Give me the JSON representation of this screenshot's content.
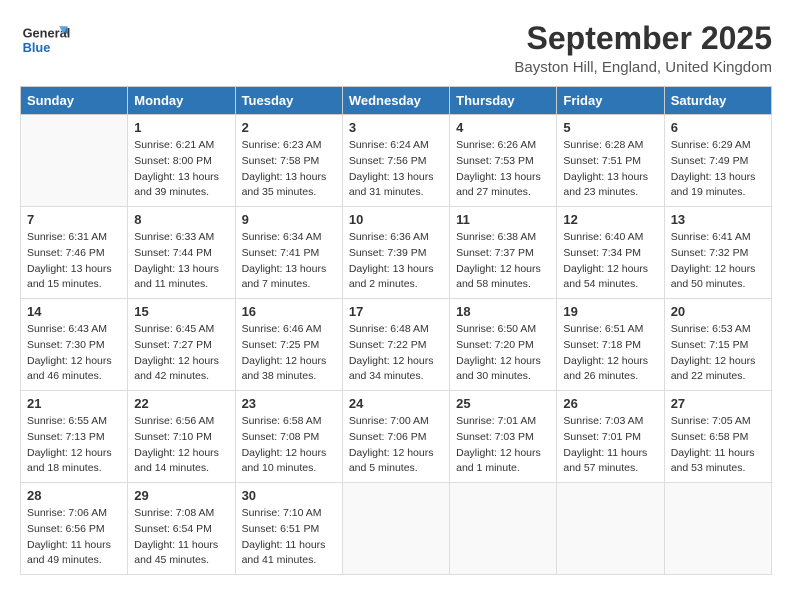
{
  "header": {
    "logo_line1": "General",
    "logo_line2": "Blue",
    "month": "September 2025",
    "location": "Bayston Hill, England, United Kingdom"
  },
  "days_of_week": [
    "Sunday",
    "Monday",
    "Tuesday",
    "Wednesday",
    "Thursday",
    "Friday",
    "Saturday"
  ],
  "weeks": [
    [
      {
        "day": "",
        "details": []
      },
      {
        "day": "1",
        "details": [
          "Sunrise: 6:21 AM",
          "Sunset: 8:00 PM",
          "Daylight: 13 hours",
          "and 39 minutes."
        ]
      },
      {
        "day": "2",
        "details": [
          "Sunrise: 6:23 AM",
          "Sunset: 7:58 PM",
          "Daylight: 13 hours",
          "and 35 minutes."
        ]
      },
      {
        "day": "3",
        "details": [
          "Sunrise: 6:24 AM",
          "Sunset: 7:56 PM",
          "Daylight: 13 hours",
          "and 31 minutes."
        ]
      },
      {
        "day": "4",
        "details": [
          "Sunrise: 6:26 AM",
          "Sunset: 7:53 PM",
          "Daylight: 13 hours",
          "and 27 minutes."
        ]
      },
      {
        "day": "5",
        "details": [
          "Sunrise: 6:28 AM",
          "Sunset: 7:51 PM",
          "Daylight: 13 hours",
          "and 23 minutes."
        ]
      },
      {
        "day": "6",
        "details": [
          "Sunrise: 6:29 AM",
          "Sunset: 7:49 PM",
          "Daylight: 13 hours",
          "and 19 minutes."
        ]
      }
    ],
    [
      {
        "day": "7",
        "details": [
          "Sunrise: 6:31 AM",
          "Sunset: 7:46 PM",
          "Daylight: 13 hours",
          "and 15 minutes."
        ]
      },
      {
        "day": "8",
        "details": [
          "Sunrise: 6:33 AM",
          "Sunset: 7:44 PM",
          "Daylight: 13 hours",
          "and 11 minutes."
        ]
      },
      {
        "day": "9",
        "details": [
          "Sunrise: 6:34 AM",
          "Sunset: 7:41 PM",
          "Daylight: 13 hours",
          "and 7 minutes."
        ]
      },
      {
        "day": "10",
        "details": [
          "Sunrise: 6:36 AM",
          "Sunset: 7:39 PM",
          "Daylight: 13 hours",
          "and 2 minutes."
        ]
      },
      {
        "day": "11",
        "details": [
          "Sunrise: 6:38 AM",
          "Sunset: 7:37 PM",
          "Daylight: 12 hours",
          "and 58 minutes."
        ]
      },
      {
        "day": "12",
        "details": [
          "Sunrise: 6:40 AM",
          "Sunset: 7:34 PM",
          "Daylight: 12 hours",
          "and 54 minutes."
        ]
      },
      {
        "day": "13",
        "details": [
          "Sunrise: 6:41 AM",
          "Sunset: 7:32 PM",
          "Daylight: 12 hours",
          "and 50 minutes."
        ]
      }
    ],
    [
      {
        "day": "14",
        "details": [
          "Sunrise: 6:43 AM",
          "Sunset: 7:30 PM",
          "Daylight: 12 hours",
          "and 46 minutes."
        ]
      },
      {
        "day": "15",
        "details": [
          "Sunrise: 6:45 AM",
          "Sunset: 7:27 PM",
          "Daylight: 12 hours",
          "and 42 minutes."
        ]
      },
      {
        "day": "16",
        "details": [
          "Sunrise: 6:46 AM",
          "Sunset: 7:25 PM",
          "Daylight: 12 hours",
          "and 38 minutes."
        ]
      },
      {
        "day": "17",
        "details": [
          "Sunrise: 6:48 AM",
          "Sunset: 7:22 PM",
          "Daylight: 12 hours",
          "and 34 minutes."
        ]
      },
      {
        "day": "18",
        "details": [
          "Sunrise: 6:50 AM",
          "Sunset: 7:20 PM",
          "Daylight: 12 hours",
          "and 30 minutes."
        ]
      },
      {
        "day": "19",
        "details": [
          "Sunrise: 6:51 AM",
          "Sunset: 7:18 PM",
          "Daylight: 12 hours",
          "and 26 minutes."
        ]
      },
      {
        "day": "20",
        "details": [
          "Sunrise: 6:53 AM",
          "Sunset: 7:15 PM",
          "Daylight: 12 hours",
          "and 22 minutes."
        ]
      }
    ],
    [
      {
        "day": "21",
        "details": [
          "Sunrise: 6:55 AM",
          "Sunset: 7:13 PM",
          "Daylight: 12 hours",
          "and 18 minutes."
        ]
      },
      {
        "day": "22",
        "details": [
          "Sunrise: 6:56 AM",
          "Sunset: 7:10 PM",
          "Daylight: 12 hours",
          "and 14 minutes."
        ]
      },
      {
        "day": "23",
        "details": [
          "Sunrise: 6:58 AM",
          "Sunset: 7:08 PM",
          "Daylight: 12 hours",
          "and 10 minutes."
        ]
      },
      {
        "day": "24",
        "details": [
          "Sunrise: 7:00 AM",
          "Sunset: 7:06 PM",
          "Daylight: 12 hours",
          "and 5 minutes."
        ]
      },
      {
        "day": "25",
        "details": [
          "Sunrise: 7:01 AM",
          "Sunset: 7:03 PM",
          "Daylight: 12 hours",
          "and 1 minute."
        ]
      },
      {
        "day": "26",
        "details": [
          "Sunrise: 7:03 AM",
          "Sunset: 7:01 PM",
          "Daylight: 11 hours",
          "and 57 minutes."
        ]
      },
      {
        "day": "27",
        "details": [
          "Sunrise: 7:05 AM",
          "Sunset: 6:58 PM",
          "Daylight: 11 hours",
          "and 53 minutes."
        ]
      }
    ],
    [
      {
        "day": "28",
        "details": [
          "Sunrise: 7:06 AM",
          "Sunset: 6:56 PM",
          "Daylight: 11 hours",
          "and 49 minutes."
        ]
      },
      {
        "day": "29",
        "details": [
          "Sunrise: 7:08 AM",
          "Sunset: 6:54 PM",
          "Daylight: 11 hours",
          "and 45 minutes."
        ]
      },
      {
        "day": "30",
        "details": [
          "Sunrise: 7:10 AM",
          "Sunset: 6:51 PM",
          "Daylight: 11 hours",
          "and 41 minutes."
        ]
      },
      {
        "day": "",
        "details": []
      },
      {
        "day": "",
        "details": []
      },
      {
        "day": "",
        "details": []
      },
      {
        "day": "",
        "details": []
      }
    ]
  ]
}
